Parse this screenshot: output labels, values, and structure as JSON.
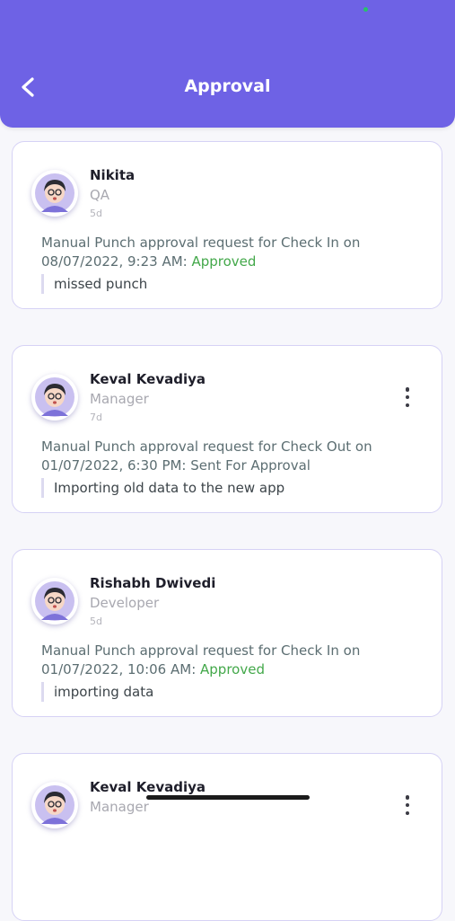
{
  "header": {
    "title": "Approval",
    "back_icon": "chevron-left-icon",
    "color": "#6e62e5"
  },
  "requests": [
    {
      "name": "Nikita",
      "role": "QA",
      "time": "5d",
      "message": "Manual Punch approval request for Check In on 08/07/2022, 9:23 AM: ",
      "status": "Approved",
      "note": "missed punch",
      "has_menu": false
    },
    {
      "name": "Keval Kevadiya",
      "role": "Manager",
      "time": "7d",
      "message": "Manual Punch approval request for Check Out on 01/07/2022, 6:30 PM: ",
      "status": "Sent For Approval",
      "note": "Importing old data to the new app",
      "has_menu": true
    },
    {
      "name": "Rishabh Dwivedi",
      "role": "Developer",
      "time": "5d",
      "message": "Manual Punch approval request for Check In on 01/07/2022, 10:06 AM: ",
      "status": "Approved",
      "note": "importing data",
      "has_menu": false
    },
    {
      "name": "Keval Kevadiya",
      "role": "Manager",
      "time": "",
      "message": "",
      "status": "",
      "note": "",
      "has_menu": true
    }
  ],
  "colors": {
    "approved": "#43a84a",
    "pending": "#5c6e72",
    "card_border": "#d6d2f5"
  }
}
